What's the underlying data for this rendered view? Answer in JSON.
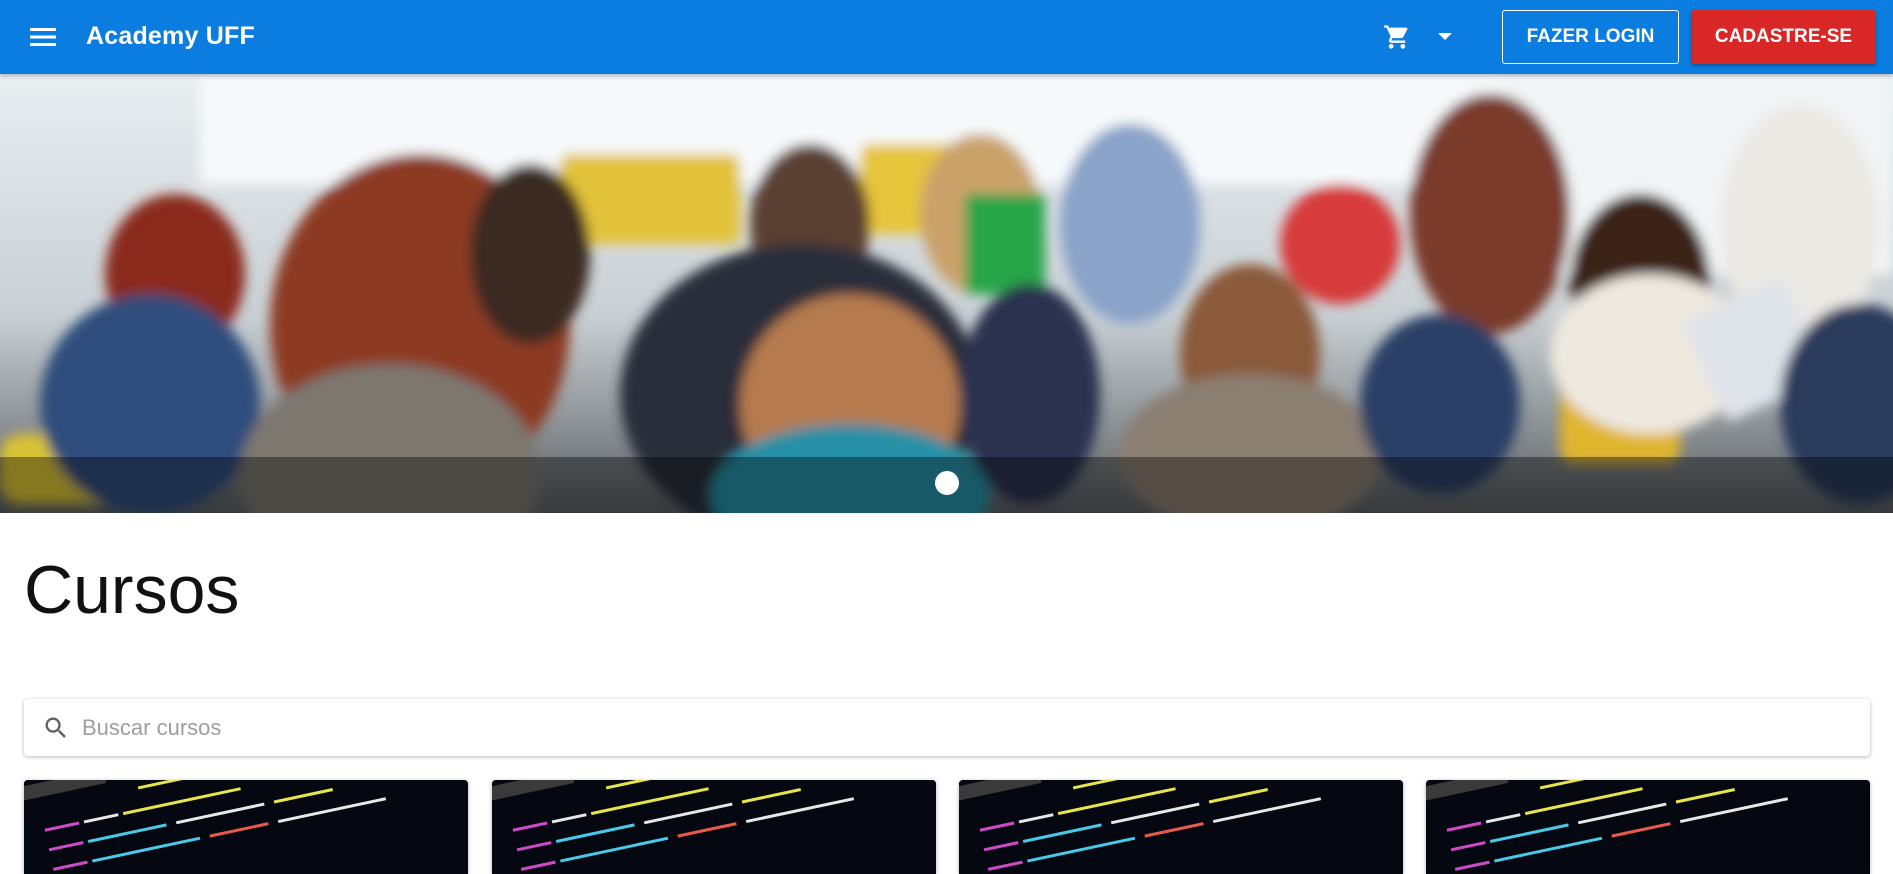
{
  "app": {
    "title": "Academy UFF"
  },
  "header": {
    "menu_icon": "menu-icon",
    "cart_icon": "cart-icon",
    "dropdown_icon": "caret-down-icon",
    "login_label": "FAZER LOGIN",
    "signup_label": "CADASTRE-SE"
  },
  "colors": {
    "appbar": "#0b7de0",
    "signup": "#d92727",
    "card_bg": "#050810"
  },
  "carousel": {
    "slide_count": 1,
    "active_slide": 1
  },
  "main": {
    "title": "Cursos",
    "search": {
      "placeholder": "Buscar cursos",
      "value": "",
      "icon": "search-icon"
    }
  },
  "courses": [
    {
      "thumbnail": "code-screen"
    },
    {
      "thumbnail": "code-screen"
    },
    {
      "thumbnail": "code-screen"
    },
    {
      "thumbnail": "code-screen"
    }
  ]
}
